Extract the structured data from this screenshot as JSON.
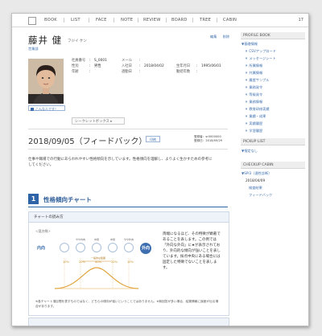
{
  "nav": {
    "items": [
      "BOOK",
      "LIST",
      "FACE",
      "NOTE",
      "REVIEW",
      "BOARD",
      "TREE",
      "CABIN"
    ],
    "page_num": "17"
  },
  "profile": {
    "name": "藤井 健",
    "kana": "フジイ ケン",
    "dept": "営業部",
    "top_links": [
      "編集",
      "削除"
    ],
    "photo_caption": "こんな人です！",
    "info_left_keys": [
      "社員番号",
      "性別",
      "年齢"
    ],
    "info_left_vals": [
      "S_0001",
      "男性",
      ""
    ],
    "info_mid_keys": [
      "メール",
      "入社日",
      "週勤日"
    ],
    "info_mid_vals": [
      "",
      "2018/04/02",
      ""
    ],
    "info_right_keys": [
      "",
      "生年月日",
      "勤続年数"
    ],
    "info_right_vals": [
      "",
      "1995/06/01",
      ""
    ],
    "secret_label": "シークレットボックス ▸"
  },
  "report": {
    "title": "2018/09/05（フィードバック）",
    "print_label": "印刷",
    "meta": [
      "登録者：sr0000000",
      "登録日：2018/09/29"
    ],
    "intro": "仕事や職場での行動にあらわれやすい性格傾向を示しています。性格傾向を理解し、よりよく生かすための参考にしてください。"
  },
  "section": {
    "num": "1",
    "title": "性格傾向チャート"
  },
  "chart": {
    "head": "チャートの読み方",
    "sub": "＜見方例＞",
    "left_pole": "内向",
    "right_pole": "外向",
    "circle_labels": [
      "やや内向",
      "中間",
      "中間",
      "やや外向"
    ],
    "percent_labels": [
      "10%",
      "20%",
      "40%",
      "20%",
      "10%"
    ],
    "range_label": "一般的な範囲",
    "selected_index": 4,
    "desc": "両端になるほど、その特徴が顕著であることを表します。この例では「外向な外向」に★が表示されており、外向的な傾向が強いことを表しています。採点中央にある場合には固定した特徴でないことを表します。",
    "note": "※各チャート項目間を表すものではなく、どちらの傾向が強いということではありません。※無回答が多い場合、結果情報に誤差が出る場合があります。"
  },
  "sidebar": {
    "profile_book": "PROFILE BOOK",
    "group1": "▼基礎情報",
    "items": [
      "CSVアップロード",
      "メッセージシート",
      "所属情報",
      "共属情報",
      "履歴サンプル",
      "業務発令",
      "等級発令",
      "業務情報",
      "教育研修実績",
      "業績・成果",
      "実績履歴",
      "学習履歴"
    ],
    "pickup": "PICKUP LIST",
    "pickup_group": "▼指定なし",
    "checkup": "CHECKUP CABIN",
    "checkup_group": "▼SPI3（適性診断）",
    "checkup_date": "2018/04/09",
    "checkup_links": [
      "検査結果",
      "フィードバック"
    ]
  }
}
